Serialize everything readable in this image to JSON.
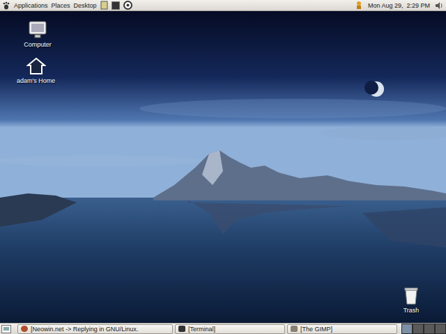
{
  "top_panel": {
    "menus": [
      "Applications",
      "Places",
      "Desktop"
    ],
    "clock": "Mon Aug 29,  2:29 PM"
  },
  "desktop_icons": [
    {
      "label": "Computer",
      "kind": "computer"
    },
    {
      "label": "adam's Home",
      "kind": "home"
    },
    {
      "label": "Trash",
      "kind": "trash"
    }
  ],
  "taskbar": [
    {
      "label": "[Neowin.net -> Replying in GNU/Linux.",
      "kind": "browser",
      "selected": false
    },
    {
      "label": "[Terminal]",
      "kind": "terminal",
      "selected": false
    },
    {
      "label": "[The GIMP]",
      "kind": "gimp",
      "selected": false
    }
  ],
  "workspaces": [
    {
      "selected": true
    },
    {
      "selected": false
    },
    {
      "selected": false
    },
    {
      "selected": false
    }
  ]
}
